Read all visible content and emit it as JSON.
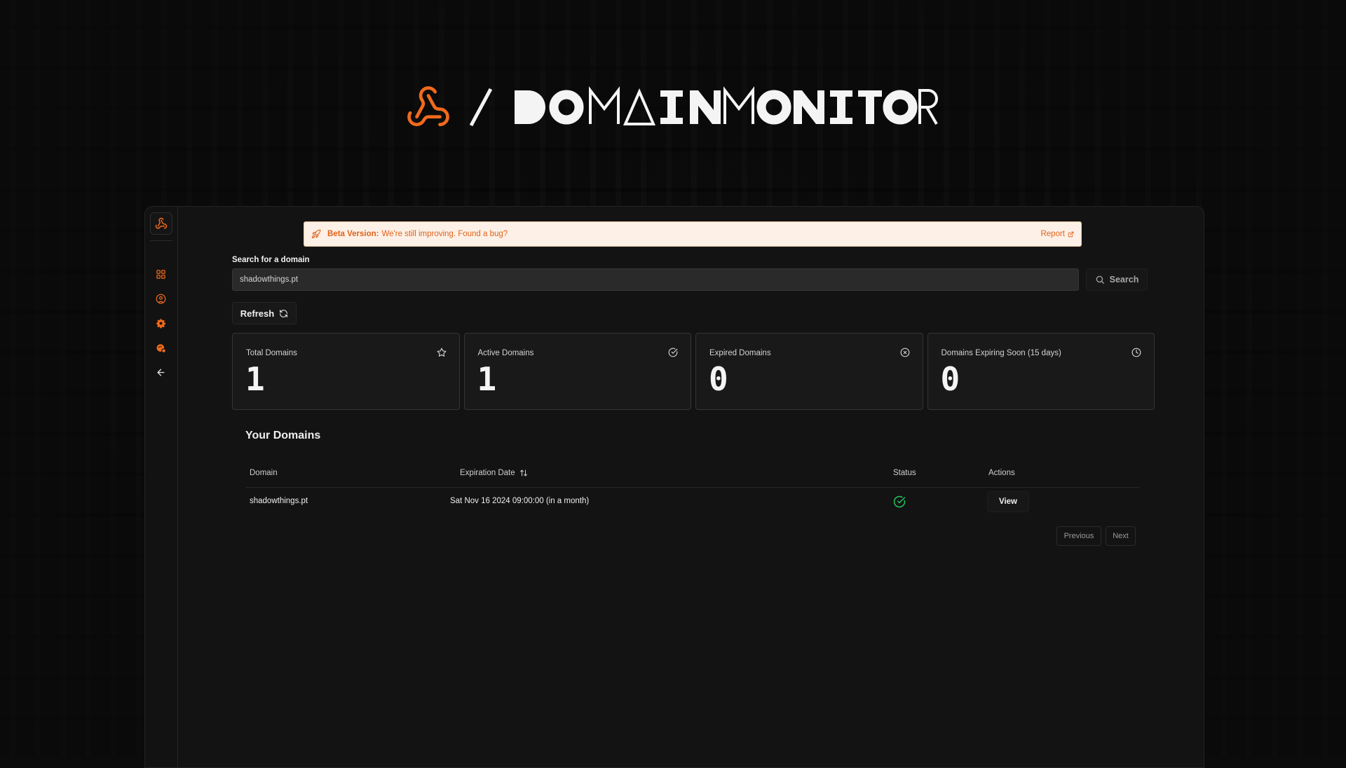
{
  "brand": {
    "wordmark": "DOMAINMONITOR",
    "accent_color": "#f26a1b",
    "logo_icon": "webhook-icon"
  },
  "sidebar": {
    "items": [
      {
        "name": "dashboard",
        "icon": "grid-icon"
      },
      {
        "name": "account",
        "icon": "user-circle-icon"
      },
      {
        "name": "settings",
        "icon": "gear-icon"
      },
      {
        "name": "bugs",
        "icon": "bug-icon"
      },
      {
        "name": "back",
        "icon": "arrow-left-icon"
      }
    ]
  },
  "banner": {
    "strong": "Beta Version:",
    "text": "We're still improving. Found a bug?",
    "link": "Report"
  },
  "search": {
    "label": "Search for a domain",
    "value": "shadowthings.pt",
    "button": "Search"
  },
  "refresh_label": "Refresh",
  "stats": [
    {
      "title": "Total Domains",
      "value": "1",
      "icon": "star-icon"
    },
    {
      "title": "Active Domains",
      "value": "1",
      "icon": "check-circle-icon"
    },
    {
      "title": "Expired Domains",
      "value": "0",
      "icon": "x-circle-icon"
    },
    {
      "title": "Domains Expiring Soon (15 days)",
      "value": "0",
      "icon": "clock-icon"
    }
  ],
  "domains": {
    "title": "Your Domains",
    "columns": [
      "Domain",
      "Expiration Date",
      "Status",
      "Actions"
    ],
    "rows": [
      {
        "domain": "shadowthings.pt",
        "expiration": "Sat Nov 16 2024 09:00:00 (in a month)",
        "status": "active",
        "action": "View"
      }
    ],
    "status_color": "#22c55e"
  },
  "pagination": {
    "previous": "Previous",
    "next": "Next"
  }
}
